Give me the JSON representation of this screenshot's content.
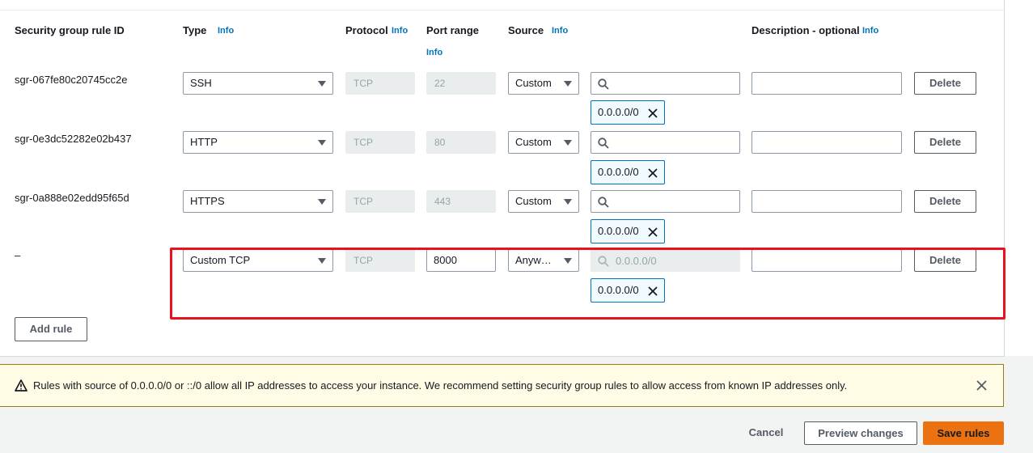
{
  "table": {
    "headers": {
      "rule_id": "Security group rule ID",
      "type": "Type",
      "protocol": "Protocol",
      "port_range": "Port range",
      "source": "Source",
      "description": "Description - optional",
      "info": "Info"
    },
    "rows": [
      {
        "rule_id": "sgr-067fe80c20745cc2e",
        "type": "SSH",
        "protocol": "TCP",
        "port": "22",
        "source_type": "Custom",
        "search_placeholder": "",
        "token": "0.0.0.0/0",
        "description": "",
        "delete": "Delete"
      },
      {
        "rule_id": "sgr-0e3dc52282e02b437",
        "type": "HTTP",
        "protocol": "TCP",
        "port": "80",
        "source_type": "Custom",
        "search_placeholder": "",
        "token": "0.0.0.0/0",
        "description": "",
        "delete": "Delete"
      },
      {
        "rule_id": "sgr-0a888e02edd95f65d",
        "type": "HTTPS",
        "protocol": "TCP",
        "port": "443",
        "source_type": "Custom",
        "search_placeholder": "",
        "token": "0.0.0.0/0",
        "description": "",
        "delete": "Delete"
      },
      {
        "rule_id": "–",
        "type": "Custom TCP",
        "protocol": "TCP",
        "port": "8000",
        "source_type": "Anyw…",
        "search_placeholder": "0.0.0.0/0",
        "token": "0.0.0.0/0",
        "description": "",
        "delete": "Delete"
      }
    ],
    "add_rule": "Add rule"
  },
  "warning": {
    "text": "Rules with source of 0.0.0.0/0 or ::/0 allow all IP addresses to access your instance. We recommend setting security group rules to allow access from known IP addresses only."
  },
  "footer": {
    "cancel": "Cancel",
    "preview": "Preview changes",
    "save": "Save rules"
  },
  "colors": {
    "accent_orange": "#ec7211",
    "info_blue": "#0073bb",
    "highlight_red": "#e8121e",
    "warning_bg": "#fffce6"
  }
}
